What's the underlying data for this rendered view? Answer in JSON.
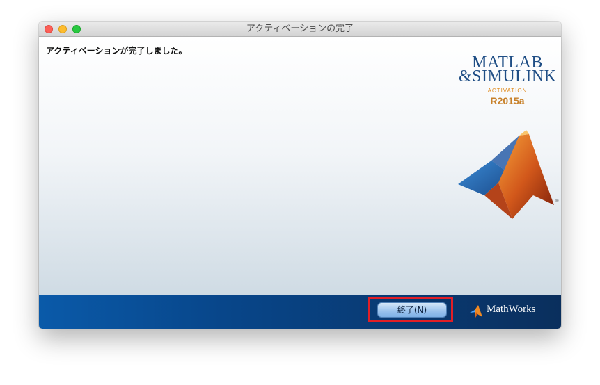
{
  "window": {
    "title": "アクティベーションの完了"
  },
  "content": {
    "message": "アクティベーションが完了しました。"
  },
  "logo": {
    "line1": "MATLAB",
    "line2": "&SIMULINK",
    "subtitle": "ACTIVATION",
    "release": "R2015a"
  },
  "footer": {
    "finish_label": "終了(N)",
    "brand": "MathWorks"
  },
  "colors": {
    "footer_blue": "#08468a",
    "highlight_red": "#e11f26",
    "button_blue": "#9dc4ee",
    "logo_text": "#1f4e85",
    "release_orange": "#c8812a"
  },
  "icons": [
    "close-button",
    "minimize-button",
    "maximize-button",
    "matlab-membrane-icon",
    "mathworks-logo-icon"
  ]
}
